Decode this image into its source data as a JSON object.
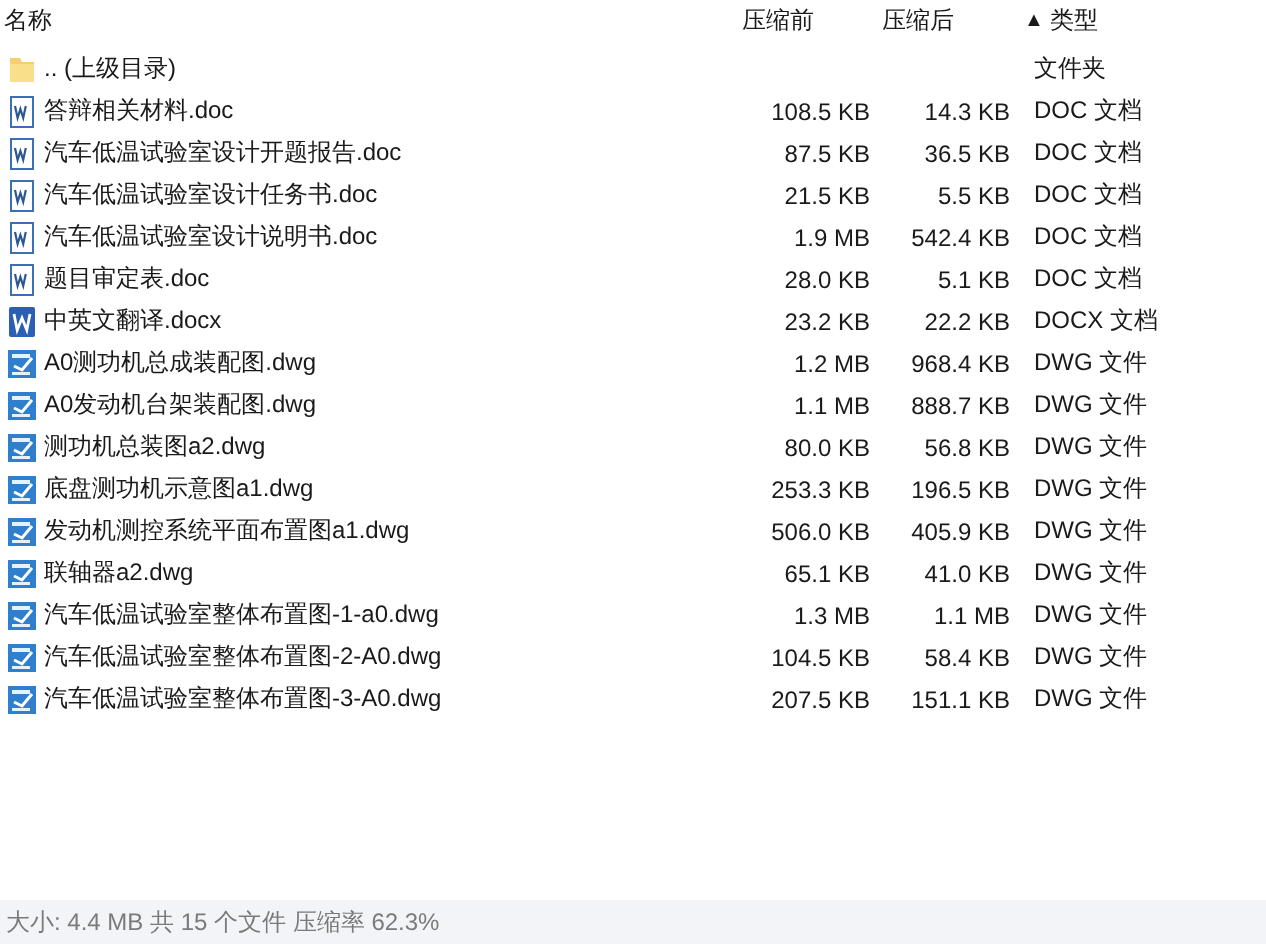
{
  "columns": [
    {
      "label": "名称"
    },
    {
      "label": "压缩前"
    },
    {
      "label": "压缩后"
    },
    {
      "label": "类型",
      "sort_glyph": "▲"
    }
  ],
  "rows": [
    {
      "kind": "folder",
      "name": ".. (上级目录)",
      "type": "文件夹"
    },
    {
      "kind": "doc",
      "name": "答辩相关材料.doc",
      "before": "108.5 KB",
      "after": "14.3 KB",
      "type": "DOC 文档"
    },
    {
      "kind": "doc",
      "name": "汽车低温试验室设计开题报告.doc",
      "before": "87.5 KB",
      "after": "36.5 KB",
      "type": "DOC 文档"
    },
    {
      "kind": "doc",
      "name": "汽车低温试验室设计任务书.doc",
      "before": "21.5 KB",
      "after": "5.5 KB",
      "type": "DOC 文档"
    },
    {
      "kind": "doc",
      "name": "汽车低温试验室设计说明书.doc",
      "before": "1.9 MB",
      "after": "542.4 KB",
      "type": "DOC 文档"
    },
    {
      "kind": "doc",
      "name": "题目审定表.doc",
      "before": "28.0 KB",
      "after": "5.1 KB",
      "type": "DOC 文档"
    },
    {
      "kind": "docx",
      "name": "中英文翻译.docx",
      "before": "23.2 KB",
      "after": "22.2 KB",
      "type": "DOCX 文档"
    },
    {
      "kind": "dwg",
      "name": "A0测功机总成装配图.dwg",
      "before": "1.2 MB",
      "after": "968.4 KB",
      "type": "DWG 文件"
    },
    {
      "kind": "dwg",
      "name": "A0发动机台架装配图.dwg",
      "before": "1.1 MB",
      "after": "888.7 KB",
      "type": "DWG 文件"
    },
    {
      "kind": "dwg",
      "name": "测功机总装图a2.dwg",
      "before": "80.0 KB",
      "after": "56.8 KB",
      "type": "DWG 文件"
    },
    {
      "kind": "dwg",
      "name": "底盘测功机示意图a1.dwg",
      "before": "253.3 KB",
      "after": "196.5 KB",
      "type": "DWG 文件"
    },
    {
      "kind": "dwg",
      "name": "发动机测控系统平面布置图a1.dwg",
      "before": "506.0 KB",
      "after": "405.9 KB",
      "type": "DWG 文件"
    },
    {
      "kind": "dwg",
      "name": "联轴器a2.dwg",
      "before": "65.1 KB",
      "after": "41.0 KB",
      "type": "DWG 文件"
    },
    {
      "kind": "dwg",
      "name": "汽车低温试验室整体布置图-1-a0.dwg",
      "before": "1.3 MB",
      "after": "1.1 MB",
      "type": "DWG 文件"
    },
    {
      "kind": "dwg",
      "name": "汽车低温试验室整体布置图-2-A0.dwg",
      "before": "104.5 KB",
      "after": "58.4 KB",
      "type": "DWG 文件"
    },
    {
      "kind": "dwg",
      "name": "汽车低温试验室整体布置图-3-A0.dwg",
      "before": "207.5 KB",
      "after": "151.1 KB",
      "type": "DWG 文件"
    }
  ],
  "status_bar": "大小: 4.4 MB 共 15 个文件 压缩率 62.3%"
}
